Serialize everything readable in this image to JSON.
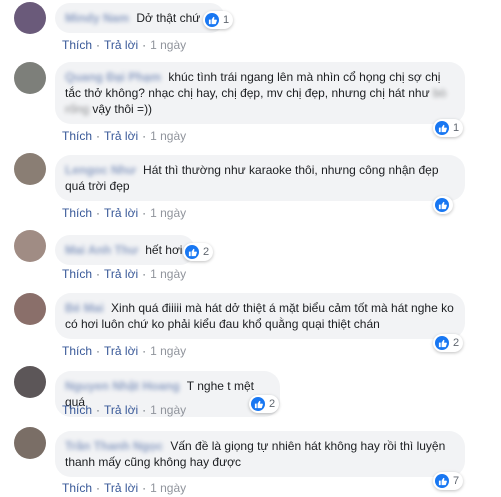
{
  "actions": {
    "like": "Thích",
    "reply": "Trả lời",
    "dot": "·"
  },
  "comments": [
    {
      "author": "Mindy Nam",
      "text": "Dở thật chứ",
      "reactions": "1",
      "time": "1 ngày",
      "avatar_color": "#6a5a7a"
    },
    {
      "author": "Quang Đại Phạm",
      "text_a": "khúc tình trái ngang lên mà nhìn cổ họng chị sợ chị tắc thở không? nhạc chị hay, chị đẹp, mv chị đẹp, nhưng chị hát như",
      "text_blur": "bò rống",
      "text_b": " vậy thôi =))",
      "reactions": "1",
      "time": "1 ngày",
      "avatar_color": "#7d7f7a"
    },
    {
      "author": "Lengoc Như",
      "text": "Hát thì thường như karaoke thôi, nhưng công nhận đẹp quá trời đẹp",
      "reactions": "",
      "time": "1 ngày",
      "avatar_color": "#8a7e74"
    },
    {
      "author": "Mai Anh Thư",
      "text": "hết hơi",
      "reactions": "2",
      "time": "1 ngày",
      "avatar_color": "#a08c84"
    },
    {
      "author": "Bé Mai",
      "text": "Xinh quá điiiii mà hát dở thiệt á mặt biểu cảm tốt mà hát nghe ko có hơi luôn chứ ko phải kiểu đau khổ quằng quại thiệt chán",
      "reactions": "2",
      "time": "1 ngày",
      "avatar_color": "#8a6f6a"
    },
    {
      "author": "Nguyen Nhật Hoang",
      "text": "T nghe t mệt quá",
      "reactions": "2",
      "time": "1 ngày",
      "avatar_color": "#5c5658"
    },
    {
      "author": "Trần Thanh Ngọc",
      "text": "Vấn đề là giọng tự nhiên hát không hay rồi thì luyện thanh mấy cũng không hay được",
      "reactions": "7",
      "time": "1 ngày",
      "avatar_color": "#7a6e66"
    }
  ]
}
